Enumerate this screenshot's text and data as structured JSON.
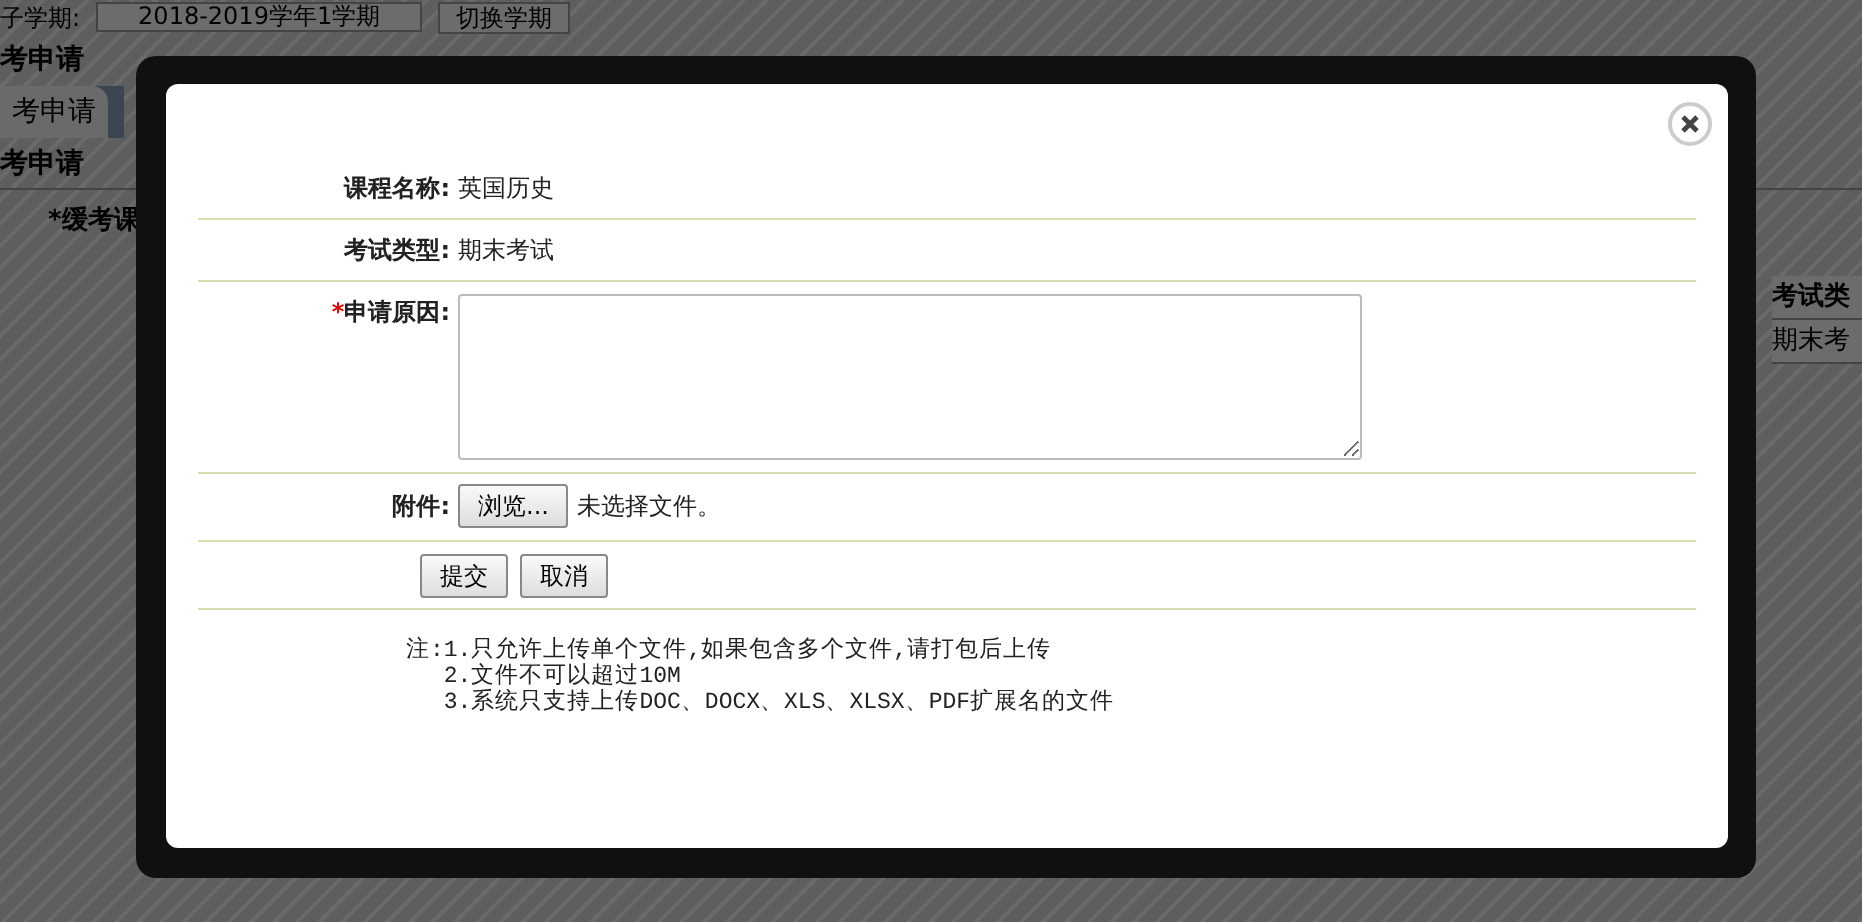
{
  "background": {
    "term_label": "子学期:",
    "term_value": "2018-2019学年1学期",
    "switch_button": "切换学期",
    "page_title": "考申请",
    "tabs": [
      {
        "label": "考申请",
        "selected": true
      }
    ],
    "section_title": "考申请",
    "required_field": {
      "mark": "*",
      "label": "缓考课"
    },
    "table": {
      "columns": [
        "考试类"
      ],
      "rows": [
        [
          "期末考"
        ]
      ]
    }
  },
  "dialog": {
    "fields": [
      {
        "kind": "text",
        "label": "课程名称:",
        "value": "英国历史"
      },
      {
        "kind": "text",
        "label": "考试类型:",
        "value": "期末考试"
      },
      {
        "kind": "textarea",
        "mark": "*",
        "label": "申请原因:"
      },
      {
        "kind": "file",
        "label": "附件:",
        "button": "浏览...",
        "status": "未选择文件。"
      }
    ],
    "buttons": [
      "提交",
      "取消"
    ],
    "notes": {
      "prefix": "注:",
      "items": [
        "1.只允许上传单个文件,如果包含多个文件,请打包后上传",
        "2.文件不可以超过10M",
        "3.系统只支持上传DOC、DOCX、XLS、XLSX、PDF扩展名的文件"
      ]
    }
  }
}
